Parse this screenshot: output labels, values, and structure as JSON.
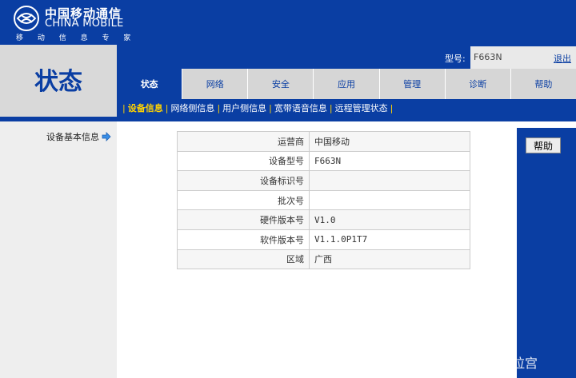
{
  "brand": {
    "name_cn": "中国移动通信",
    "name_en": "CHINA MOBILE",
    "slogan": "移 动 信 息 专 家"
  },
  "page_title": "状态",
  "header": {
    "model_label": "型号:",
    "model_value": "F663N",
    "logout": "退出"
  },
  "tabs": [
    {
      "label": "状态",
      "active": true
    },
    {
      "label": "网络",
      "active": false
    },
    {
      "label": "安全",
      "active": false
    },
    {
      "label": "应用",
      "active": false
    },
    {
      "label": "管理",
      "active": false
    },
    {
      "label": "诊断",
      "active": false
    },
    {
      "label": "帮助",
      "active": false
    }
  ],
  "subtabs": [
    {
      "label": "设备信息",
      "active": true
    },
    {
      "label": "网络侧信息",
      "active": false
    },
    {
      "label": "用户侧信息",
      "active": false
    },
    {
      "label": "宽带语音信息",
      "active": false
    },
    {
      "label": "远程管理状态",
      "active": false
    }
  ],
  "sidebar": {
    "item": "设备基本信息"
  },
  "help_button": "帮助",
  "device_info": [
    {
      "label": "运营商",
      "value": "中国移动"
    },
    {
      "label": "设备型号",
      "value": "F663N"
    },
    {
      "label": "设备标识号",
      "value": ""
    },
    {
      "label": "批次号",
      "value": ""
    },
    {
      "label": "硬件版本号",
      "value": "V1.0"
    },
    {
      "label": "软件版本号",
      "value": "V1.1.0P1T7"
    },
    {
      "label": "区域",
      "value": "广西"
    }
  ],
  "watermark": "酷安@玉林小布达拉宫",
  "colors": {
    "primary": "#0a3ea3",
    "tab_inactive": "#d6d6d6",
    "subtab_active": "#ffd200"
  }
}
